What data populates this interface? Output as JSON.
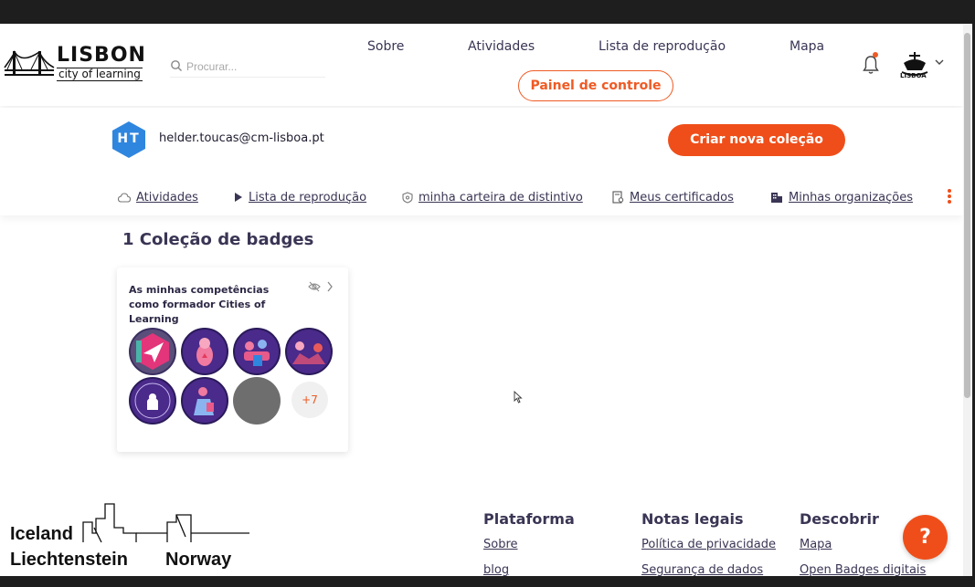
{
  "header": {
    "logo_title": "LISBON",
    "logo_subtitle": "city of learning",
    "search_placeholder": "Procurar...",
    "nav": [
      "Sobre",
      "Atividades",
      "Lista de reprodução",
      "Mapa"
    ],
    "panel_button": "Painel de controle",
    "org_logo_text": "LISBOA"
  },
  "profile": {
    "initials": "HT",
    "email": "helder.toucas@cm-lisboa.pt",
    "create_button": "Criar nova coleção",
    "tabs": [
      "Atividades",
      "Lista de reprodução",
      "minha carteira de distintivo",
      "Meus certificados",
      "Minhas organizações"
    ]
  },
  "collections": {
    "title": "1 Coleção de badges",
    "card": {
      "title": "As minhas competências como formador Cities of Learning",
      "more_count": "+7"
    }
  },
  "footer": {
    "brand": {
      "line1": "Iceland",
      "line2": "Liechtenstein",
      "line3": "Norway"
    },
    "columns": [
      {
        "title": "Plataforma",
        "links": [
          "Sobre",
          "blog"
        ]
      },
      {
        "title": "Notas legais",
        "links": [
          "Política de privacidade",
          "Segurança de dados"
        ]
      },
      {
        "title": "Descobrir",
        "links": [
          "Mapa",
          "Open Badges digitais"
        ]
      }
    ],
    "help_label": "?"
  },
  "colors": {
    "accent": "#ef4e1a",
    "text": "#3a3554",
    "avatar": "#2f86df",
    "badge_purple": "#4a2a8a"
  }
}
